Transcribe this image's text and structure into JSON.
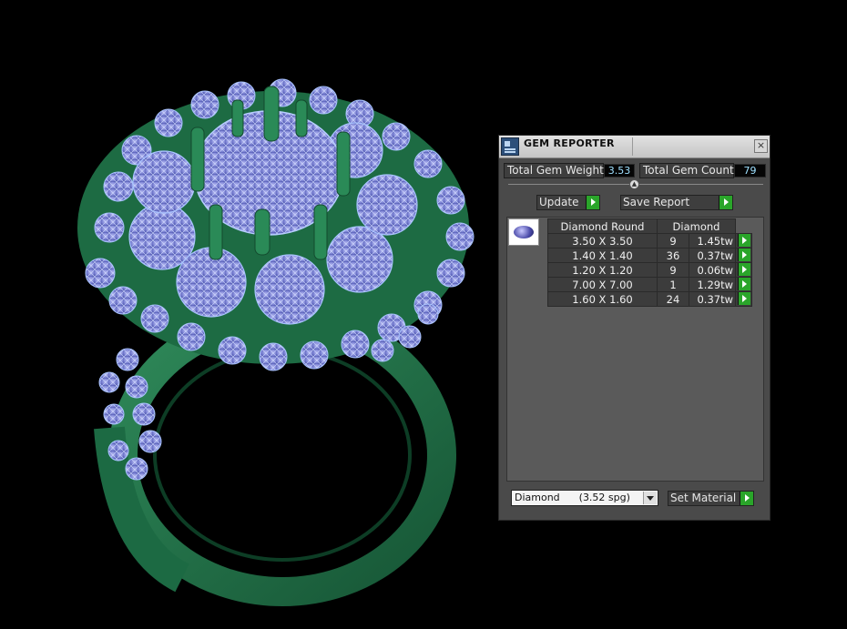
{
  "panel": {
    "title": "GEM REPORTER",
    "close_glyph": "×",
    "total_weight_label": "Total Gem Weight",
    "total_weight_value": "3.53",
    "total_count_label": "Total Gem Count",
    "total_count_value": "79",
    "update_label": "Update",
    "save_report_label": "Save Report",
    "header_shape": "Diamond Round",
    "header_material": "Diamond",
    "rows": [
      {
        "size": "3.50 X 3.50",
        "count": "9",
        "weight": "1.45tw"
      },
      {
        "size": "1.40 X 1.40",
        "count": "36",
        "weight": "0.37tw"
      },
      {
        "size": "1.20 X 1.20",
        "count": "9",
        "weight": "0.06tw"
      },
      {
        "size": "7.00 X 7.00",
        "count": "1",
        "weight": "1.29tw"
      },
      {
        "size": "1.60 X 1.60",
        "count": "24",
        "weight": "0.37tw"
      }
    ],
    "material_select": "Diamond      (3.52 spg)",
    "set_material_label": "Set Material"
  },
  "colors": {
    "metal": "#1f6b44",
    "metal_highlight": "#3aa36b",
    "gem_wire": "#8fb3ff",
    "accent_go": "#2aa52a"
  }
}
